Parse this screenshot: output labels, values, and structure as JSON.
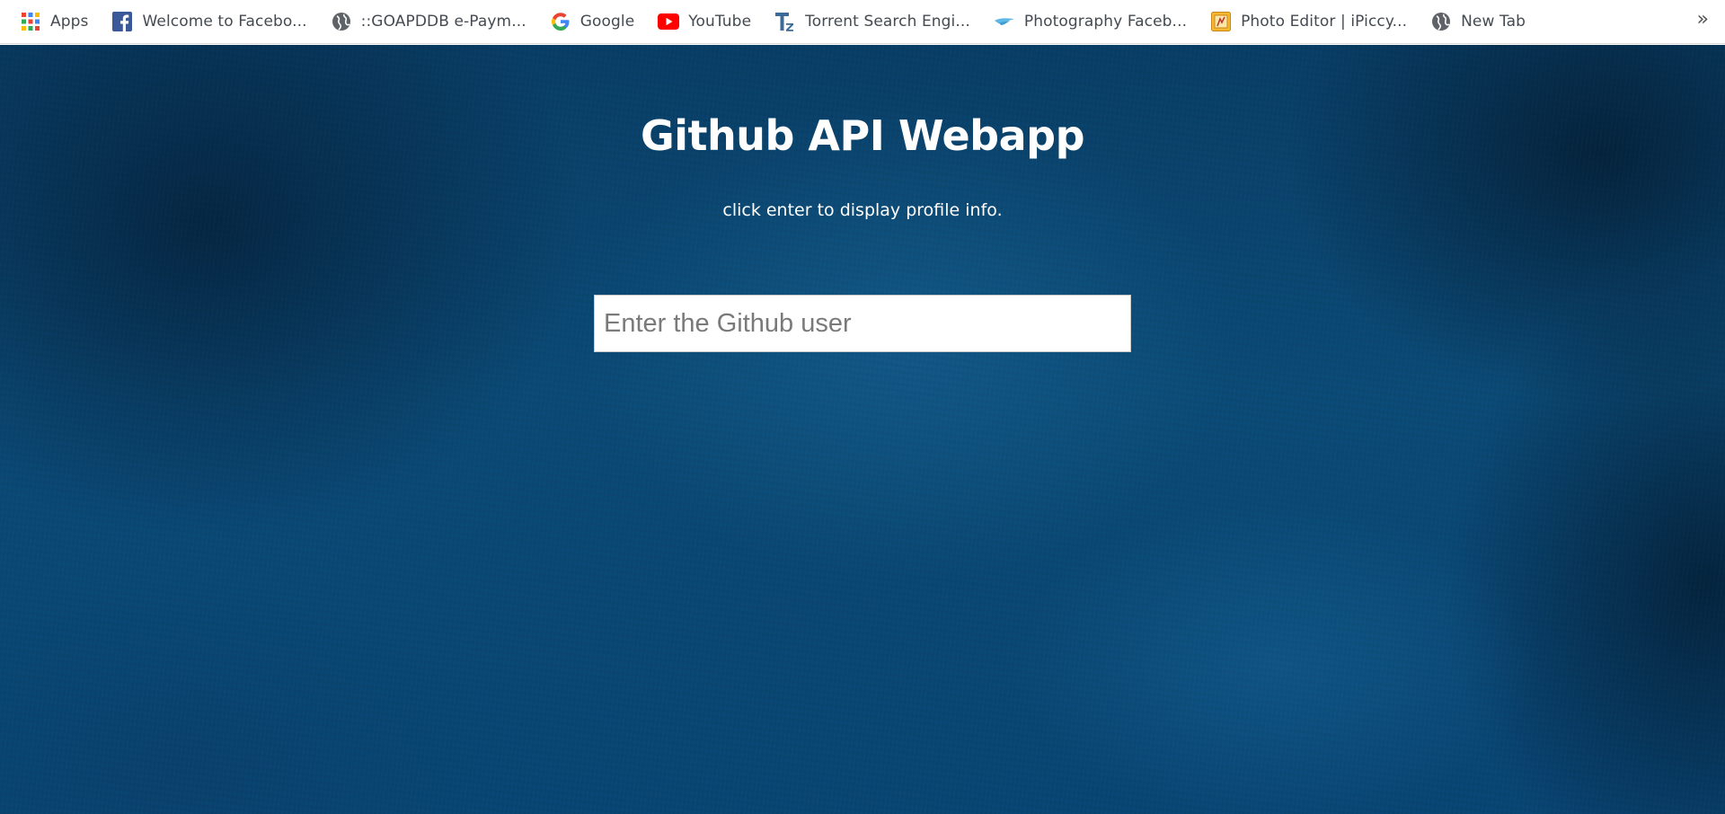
{
  "bookmarks": {
    "items": [
      {
        "label": "Apps",
        "icon": "apps-grid-icon"
      },
      {
        "label": "Welcome to Facebo...",
        "icon": "facebook-icon"
      },
      {
        "label": "::GOAPDDB e-Paym...",
        "icon": "globe-icon"
      },
      {
        "label": "Google",
        "icon": "google-icon"
      },
      {
        "label": "YouTube",
        "icon": "youtube-icon"
      },
      {
        "label": "Torrent Search Engi...",
        "icon": "torrentz-icon"
      },
      {
        "label": "Photography Faceb...",
        "icon": "photography-wing-icon"
      },
      {
        "label": "Photo Editor | iPiccy...",
        "icon": "photo-editor-icon"
      },
      {
        "label": "New Tab",
        "icon": "globe-icon"
      }
    ],
    "overflow": "»"
  },
  "page": {
    "title": "Github API Webapp",
    "subtitle": "click enter to display profile info."
  },
  "search": {
    "placeholder": "Enter the Github user",
    "value": ""
  },
  "colors": {
    "background": "#0a4a76",
    "text": "#ffffff",
    "bookmark_bar": "#ffffff"
  }
}
